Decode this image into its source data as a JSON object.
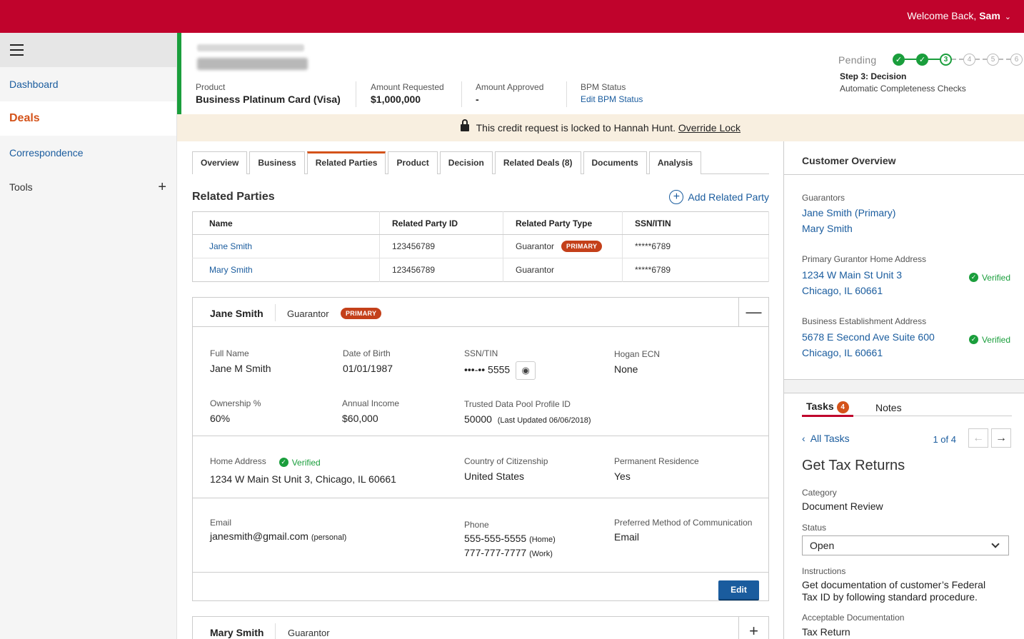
{
  "topbar": {
    "welcome_prefix": "Welcome Back,",
    "user": "Sam"
  },
  "sidebar": {
    "items": [
      {
        "label": "Dashboard"
      },
      {
        "label": "Deals"
      },
      {
        "label": "Correspondence"
      },
      {
        "label": "Tools"
      }
    ]
  },
  "header": {
    "product_label": "Product",
    "product_value": "Business Platinum Card (Visa)",
    "amount_requested_label": "Amount Requested",
    "amount_requested_value": "$1,000,000",
    "amount_approved_label": "Amount Approved",
    "amount_approved_value": "-",
    "bpm_label": "BPM Status",
    "bpm_link": "Edit BPM Status",
    "status": "Pending",
    "steps": [
      "✓",
      "✓",
      "3",
      "4",
      "5",
      "6"
    ],
    "step_title": "Step 3: Decision",
    "step_sub": "Automatic Completeness Checks"
  },
  "lock": {
    "text": "This credit request is locked to Hannah Hunt.",
    "link": "Override Lock"
  },
  "tabs": [
    "Overview",
    "Business",
    "Related Parties",
    "Product",
    "Decision",
    "Related Deals (8)",
    "Documents",
    "Analysis"
  ],
  "related_parties": {
    "title": "Related Parties",
    "add_label": "Add Related Party",
    "columns": [
      "Name",
      "Related Party ID",
      "Related Party Type",
      "SSN/ITIN"
    ],
    "rows": [
      {
        "name": "Jane Smith",
        "id": "123456789",
        "type": "Guarantor",
        "badge": "PRIMARY",
        "ssn": "*****6789"
      },
      {
        "name": "Mary Smith",
        "id": "123456789",
        "type": "Guarantor",
        "badge": "",
        "ssn": "*****6789"
      }
    ]
  },
  "detail": {
    "name": "Jane Smith",
    "role": "Guarantor",
    "badge": "PRIMARY",
    "full_name_label": "Full Name",
    "full_name": "Jane M Smith",
    "dob_label": "Date of Birth",
    "dob": "01/01/1987",
    "ssn_label": "SSN/TIN",
    "ssn": "•••-•• 5555",
    "hogan_label": "Hogan ECN",
    "hogan": "None",
    "ownership_label": "Ownership %",
    "ownership": "60%",
    "income_label": "Annual Income",
    "income": "$60,000",
    "tdp_label": "Trusted Data Pool Profile ID",
    "tdp": "50000",
    "tdp_note": "(Last Updated 06/06/2018)",
    "home_label": "Home Address",
    "verified": "Verified",
    "home": "1234 W Main St Unit 3, Chicago, IL 60661",
    "citizenship_label": "Country of Citizenship",
    "citizenship": "United States",
    "residence_label": "Permanent Residence",
    "residence": "Yes",
    "email_label": "Email",
    "email": "janesmith@gmail.com",
    "email_note": "(personal)",
    "phone_label": "Phone",
    "phone1": "555-555-5555",
    "phone1_note": "(Home)",
    "phone2": "777-777-7777",
    "phone2_note": "(Work)",
    "pref_label": "Preferred Method of Communication",
    "pref": "Email",
    "edit": "Edit"
  },
  "detail2": {
    "name": "Mary Smith",
    "role": "Guarantor"
  },
  "customer_overview": {
    "title": "Customer Overview",
    "guarantors_label": "Guarantors",
    "guarantor1": "Jane Smith (Primary)",
    "guarantor2": "Mary Smith",
    "home_label": "Primary Gurantor Home Address",
    "home1": "1234 W Main St Unit 3",
    "home2": "Chicago, IL 60661",
    "biz_label": "Business Establishment Address",
    "biz1": "5678 E Second Ave Suite 600",
    "biz2": "Chicago, IL 60661",
    "verified": "Verified"
  },
  "tasks": {
    "tab_tasks": "Tasks",
    "count": "4",
    "tab_notes": "Notes",
    "all_tasks": "All Tasks",
    "pager": "1 of 4",
    "title": "Get Tax Returns",
    "category_label": "Category",
    "category": "Document Review",
    "status_label": "Status",
    "status": "Open",
    "instructions_label": "Instructions",
    "instructions1": "Get documentation of customer’s Federal",
    "instructions2": "Tax ID by following standard procedure.",
    "docs_label": "Acceptable Documentation",
    "docs": "Tax Return"
  }
}
